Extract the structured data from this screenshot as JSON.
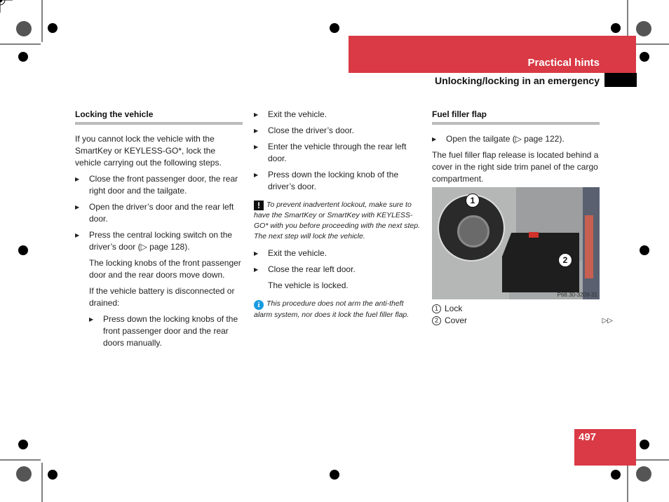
{
  "header": {
    "section": "Practical hints",
    "subtitle": "Unlocking/locking in an emergency",
    "page_number": "497"
  },
  "left": {
    "heading": "Locking the vehicle",
    "intro": "If you cannot lock the vehicle with the SmartKey or KEYLESS-GO*, lock the vehicle carrying out the following steps.",
    "steps": [
      "Close the front passenger door, the rear right door and the tailgate.",
      "Open the driver’s door and the rear left door.",
      "Press the central locking switch on the driver’s door (▷ page 128)."
    ],
    "result": "The locking knobs of the front passenger door and the rear doors move down.",
    "battery": "If the vehicle battery is disconnected or drained:",
    "substep": "Press down the locking knobs of the front passenger door and the rear doors manually."
  },
  "middle": {
    "steps1": [
      "Exit the vehicle.",
      "Close the driver’s door.",
      "Enter the vehicle through the rear left door.",
      "Press down the locking knob of the driver’s door."
    ],
    "warning": "To prevent inadvertent lockout, make sure to have the SmartKey or SmartKey with KEYLESS-GO* with you before proceeding with the next step. The next step will lock the vehicle.",
    "steps2": [
      "Exit the vehicle.",
      "Close the rear left door."
    ],
    "result": "The vehicle is locked.",
    "info": "This procedure does not arm the anti-theft alarm system, nor does it lock the fuel filler flap."
  },
  "right": {
    "heading": "Fuel filler flap",
    "step": "Open the tailgate (▷ page 122).",
    "text": "The fuel filler flap release is located behind a cover in the right side trim panel of the cargo compartment.",
    "image_code": "P68.30-3209-31",
    "callouts": [
      "1",
      "2"
    ],
    "legend": [
      {
        "num": "1",
        "label": "Lock"
      },
      {
        "num": "2",
        "label": "Cover"
      }
    ],
    "continue": "▷▷"
  },
  "icons": {
    "warning": "!",
    "info": "i"
  },
  "colors": {
    "accent": "#d93a45",
    "info": "#1a9be0"
  }
}
